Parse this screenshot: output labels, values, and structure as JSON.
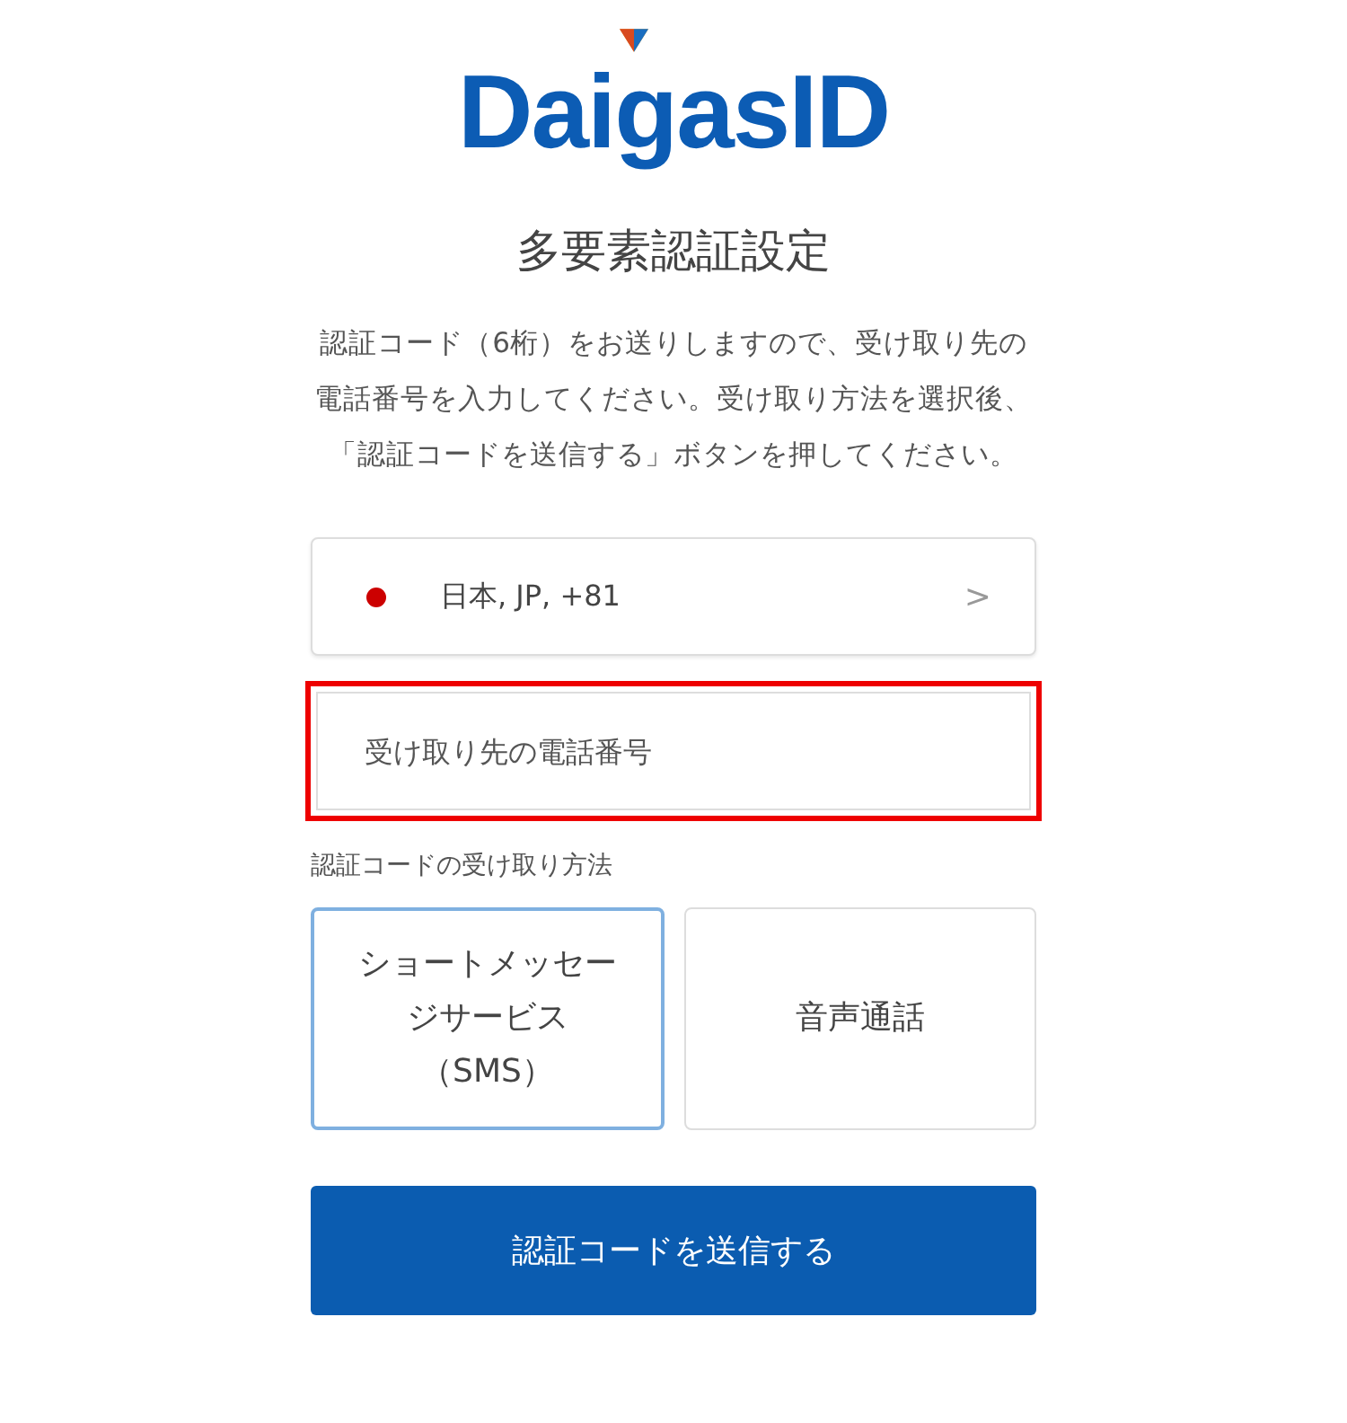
{
  "logo": {
    "text": "DaigasID"
  },
  "title": "多要素認証設定",
  "description": "認証コード（6桁）をお送りしますので、受け取り先の電話番号を入力してください。受け取り方法を選択後、「認証コードを送信する」ボタンを押してください。",
  "country_selector": {
    "value": "日本, JP, +81",
    "color": "#cc0000",
    "chevron": ">"
  },
  "phone_field": {
    "placeholder": "受け取り先の電話番号",
    "highlighted": true
  },
  "method_label": "認証コードの受け取り方法",
  "methods": [
    {
      "label": "ショートメッセージサービス（SMS）",
      "selected": true
    },
    {
      "label": "音声通話",
      "selected": false
    }
  ],
  "submit_button": "認証コードを送信する"
}
